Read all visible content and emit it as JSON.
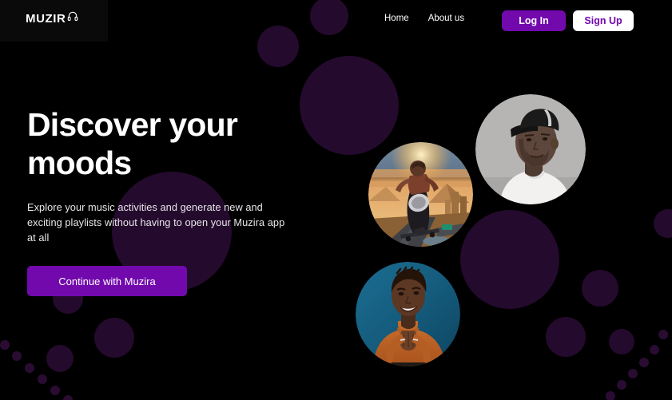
{
  "page": {
    "background_color": "#000000",
    "accent_color": "#7209ad",
    "decor_color": "#240a2d"
  },
  "header": {
    "logo": {
      "text": "MUZIR",
      "icon": "headphones-icon",
      "full_name": "MUZIRA"
    },
    "nav": [
      {
        "label": "Home"
      },
      {
        "label": "About us"
      }
    ],
    "actions": {
      "login_label": "Log In",
      "signup_label": "Sign Up"
    }
  },
  "hero": {
    "headline": "Discover your moods",
    "subtext": "Explore your music activities and generate  new and exciting playlists without having to open your Muzira app at all",
    "cta_label": "Continue with Muzira"
  },
  "media": {
    "circles": [
      {
        "name": "artist-portrait",
        "description": "Black and white portrait of a man wearing a cap and white t-shirt"
      },
      {
        "name": "album-art",
        "description": "Illustrated album cover of a figure riding a skateboard through a golden desert landscape"
      },
      {
        "name": "smiling-artist",
        "description": "Smiling young man in a rust orange turtleneck against a teal blue backdrop"
      }
    ]
  }
}
